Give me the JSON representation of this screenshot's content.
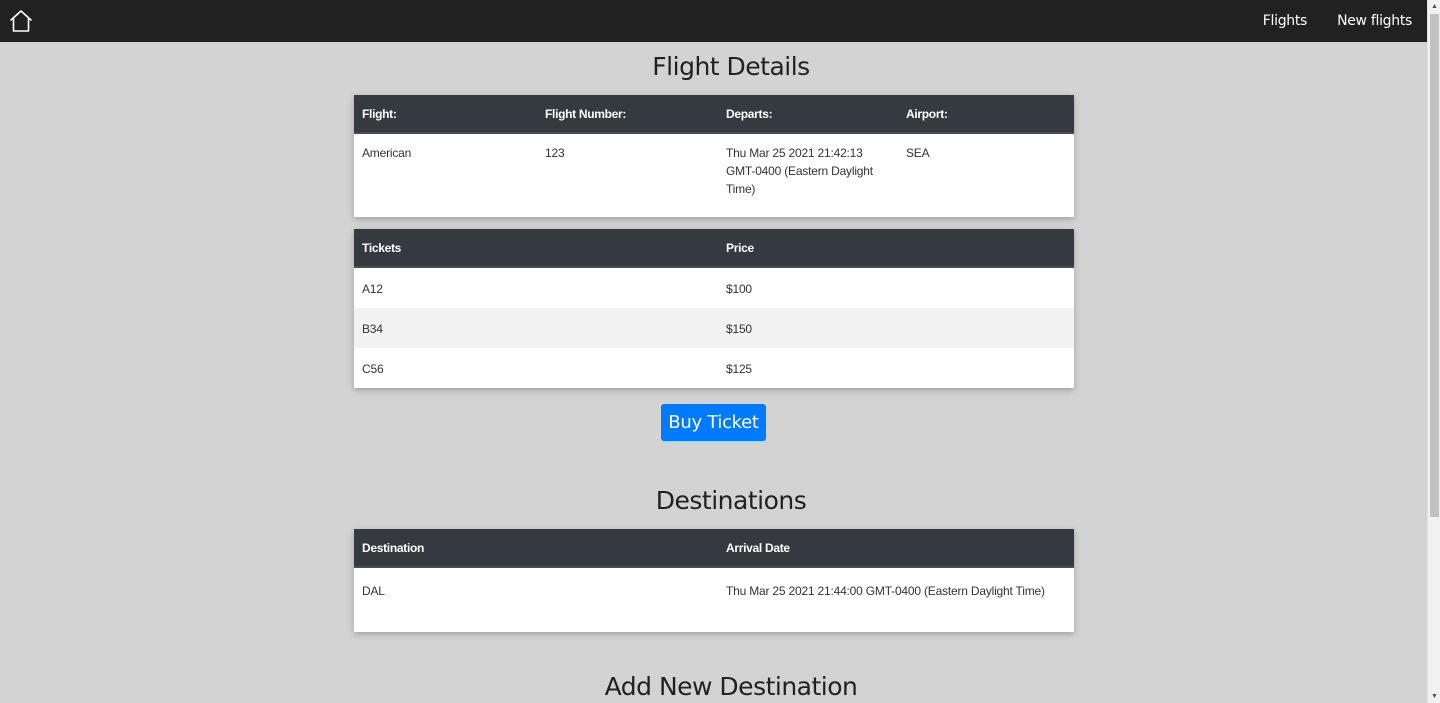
{
  "nav": {
    "home_icon": "home-icon",
    "links": [
      "Flights",
      "New flights"
    ]
  },
  "flight_details": {
    "title": "Flight Details",
    "headers": [
      "Flight:",
      "Flight Number:",
      "Departs:",
      "Airport:"
    ],
    "row": [
      "American",
      "123",
      "Thu Mar 25 2021 21:42:13 GMT-0400 (Eastern Daylight Time)",
      "SEA"
    ]
  },
  "tickets": {
    "headers": [
      "Tickets",
      "Price"
    ],
    "rows": [
      [
        "A12",
        "$100"
      ],
      [
        "B34",
        "$150"
      ],
      [
        "C56",
        "$125"
      ]
    ]
  },
  "buy_button": "Buy Ticket",
  "destinations": {
    "title": "Destinations",
    "headers": [
      "Destination",
      "Arrival Date"
    ],
    "rows": [
      [
        "DAL",
        "Thu Mar 25 2021 21:44:00 GMT-0400 (Eastern Daylight Time)"
      ]
    ]
  },
  "add_destination": {
    "title": "Add New Destination"
  },
  "colors": {
    "navbar": "#212121",
    "background": "#d3d3d3",
    "table_header": "#343a40",
    "button": "#007bff"
  }
}
